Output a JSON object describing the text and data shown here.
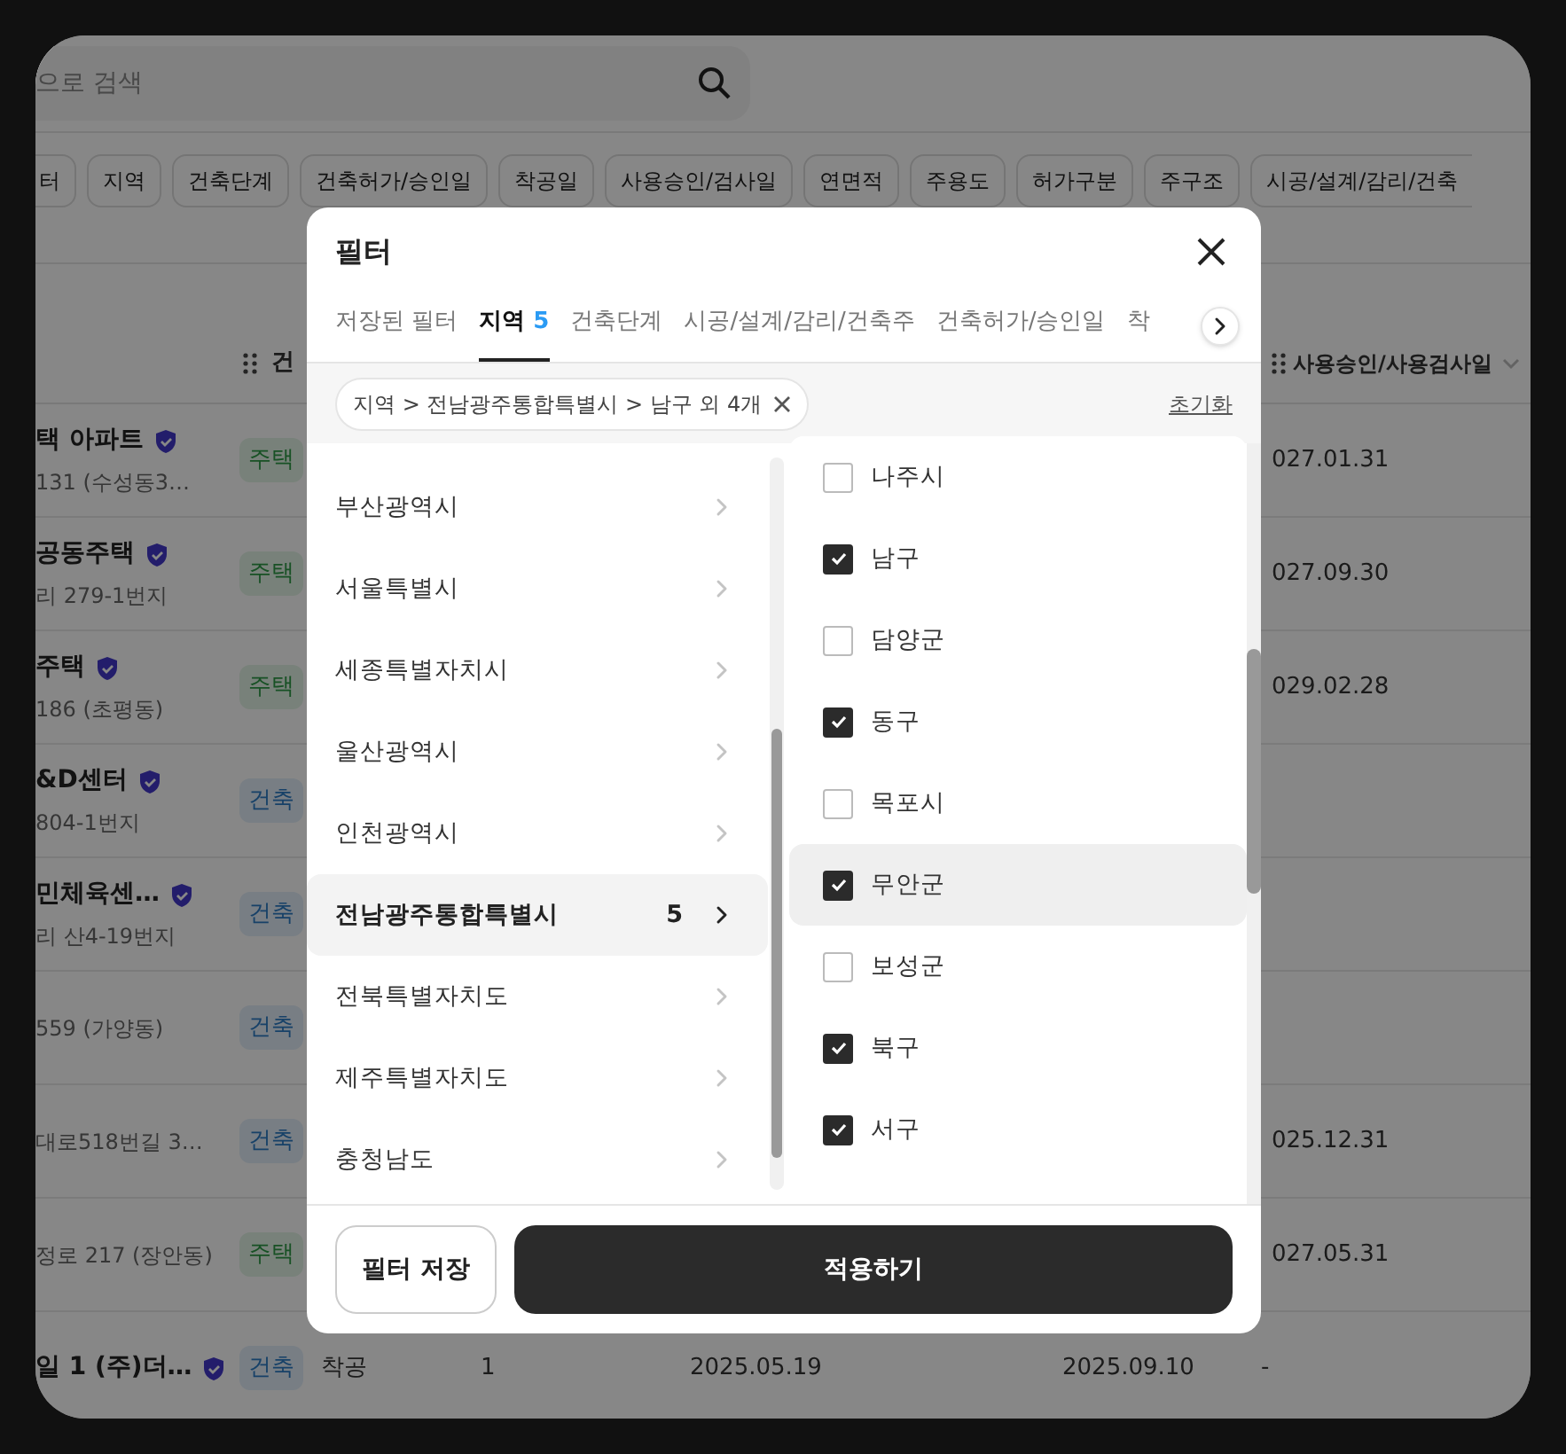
{
  "search": {
    "placeholder": "으로 검색"
  },
  "filter_chips": [
    "터",
    "지역",
    "건축단계",
    "건축허가/승인일",
    "착공일",
    "사용승인/검사일",
    "연면적",
    "주용도",
    "허가구분",
    "주구조",
    "시공/설계/감리/건축"
  ],
  "table": {
    "columns": [
      "건",
      "사용승인/사용검사일"
    ],
    "rows": [
      {
        "name": "택 아파트",
        "verified": true,
        "address": "131 (수성동3…",
        "tag": {
          "label": "주택",
          "kind": "housing"
        },
        "date": "027.01.31"
      },
      {
        "name": "공동주택",
        "verified": true,
        "address": "리 279-1번지",
        "tag": {
          "label": "주택",
          "kind": "housing"
        },
        "date": "027.09.30"
      },
      {
        "name": "주택",
        "verified": true,
        "address": "186 (초평동)",
        "tag": {
          "label": "주택",
          "kind": "housing"
        },
        "date": "029.02.28"
      },
      {
        "name": "&D센터",
        "verified": true,
        "address": "804-1번지",
        "tag": {
          "label": "건축",
          "kind": "building"
        }
      },
      {
        "name": "민체육센…",
        "verified": true,
        "address": "리 산4-19번지",
        "tag": {
          "label": "건축",
          "kind": "building"
        }
      },
      {
        "address": "559 (가양동)",
        "tag": {
          "label": "건축",
          "kind": "building"
        }
      },
      {
        "address": "대로518번길 3…",
        "tag": {
          "label": "건축",
          "kind": "building"
        },
        "date": "025.12.31"
      },
      {
        "address": "정로 217 (장안동)",
        "tag": {
          "label": "주택",
          "kind": "housing"
        },
        "date": "027.05.31"
      },
      {
        "name": "일 1 (주)더…",
        "verified": true,
        "tag": {
          "label": "건축",
          "kind": "building"
        },
        "extra": [
          "착공",
          "1",
          "2025.05.19",
          "2025.09.10",
          "-"
        ]
      }
    ]
  },
  "dialog": {
    "title": "필터",
    "tabs": [
      {
        "label": "저장된 필터",
        "selected": false
      },
      {
        "label": "지역",
        "count": "5",
        "selected": true
      },
      {
        "label": "건축단계",
        "selected": false
      },
      {
        "label": "시공/설계/감리/건축주",
        "selected": false
      },
      {
        "label": "건축허가/승인일",
        "selected": false
      },
      {
        "label": "착",
        "selected": false
      }
    ],
    "applied_filter": "지역 > 전남광주통합특별시 > 남구 외 4개",
    "reset": "초기화",
    "regions": [
      {
        "label": "부산광역시",
        "selected": false
      },
      {
        "label": "서울특별시",
        "selected": false
      },
      {
        "label": "세종특별자치시",
        "selected": false
      },
      {
        "label": "울산광역시",
        "selected": false
      },
      {
        "label": "인천광역시",
        "selected": false
      },
      {
        "label": "전남광주통합특별시",
        "count": "5",
        "selected": true
      },
      {
        "label": "전북특별자치도",
        "selected": false
      },
      {
        "label": "제주특별자치도",
        "selected": false
      },
      {
        "label": "충청남도",
        "selected": false
      }
    ],
    "districts": [
      {
        "label": "나주시",
        "checked": false,
        "hovered": false
      },
      {
        "label": "남구",
        "checked": true,
        "hovered": false
      },
      {
        "label": "담양군",
        "checked": false,
        "hovered": false
      },
      {
        "label": "동구",
        "checked": true,
        "hovered": false
      },
      {
        "label": "목포시",
        "checked": false,
        "hovered": false
      },
      {
        "label": "무안군",
        "checked": true,
        "hovered": true
      },
      {
        "label": "보성군",
        "checked": false,
        "hovered": false
      },
      {
        "label": "북구",
        "checked": true,
        "hovered": false
      },
      {
        "label": "서구",
        "checked": true,
        "hovered": false
      }
    ],
    "buttons": {
      "save": "필터 저장",
      "apply": "적용하기"
    }
  }
}
